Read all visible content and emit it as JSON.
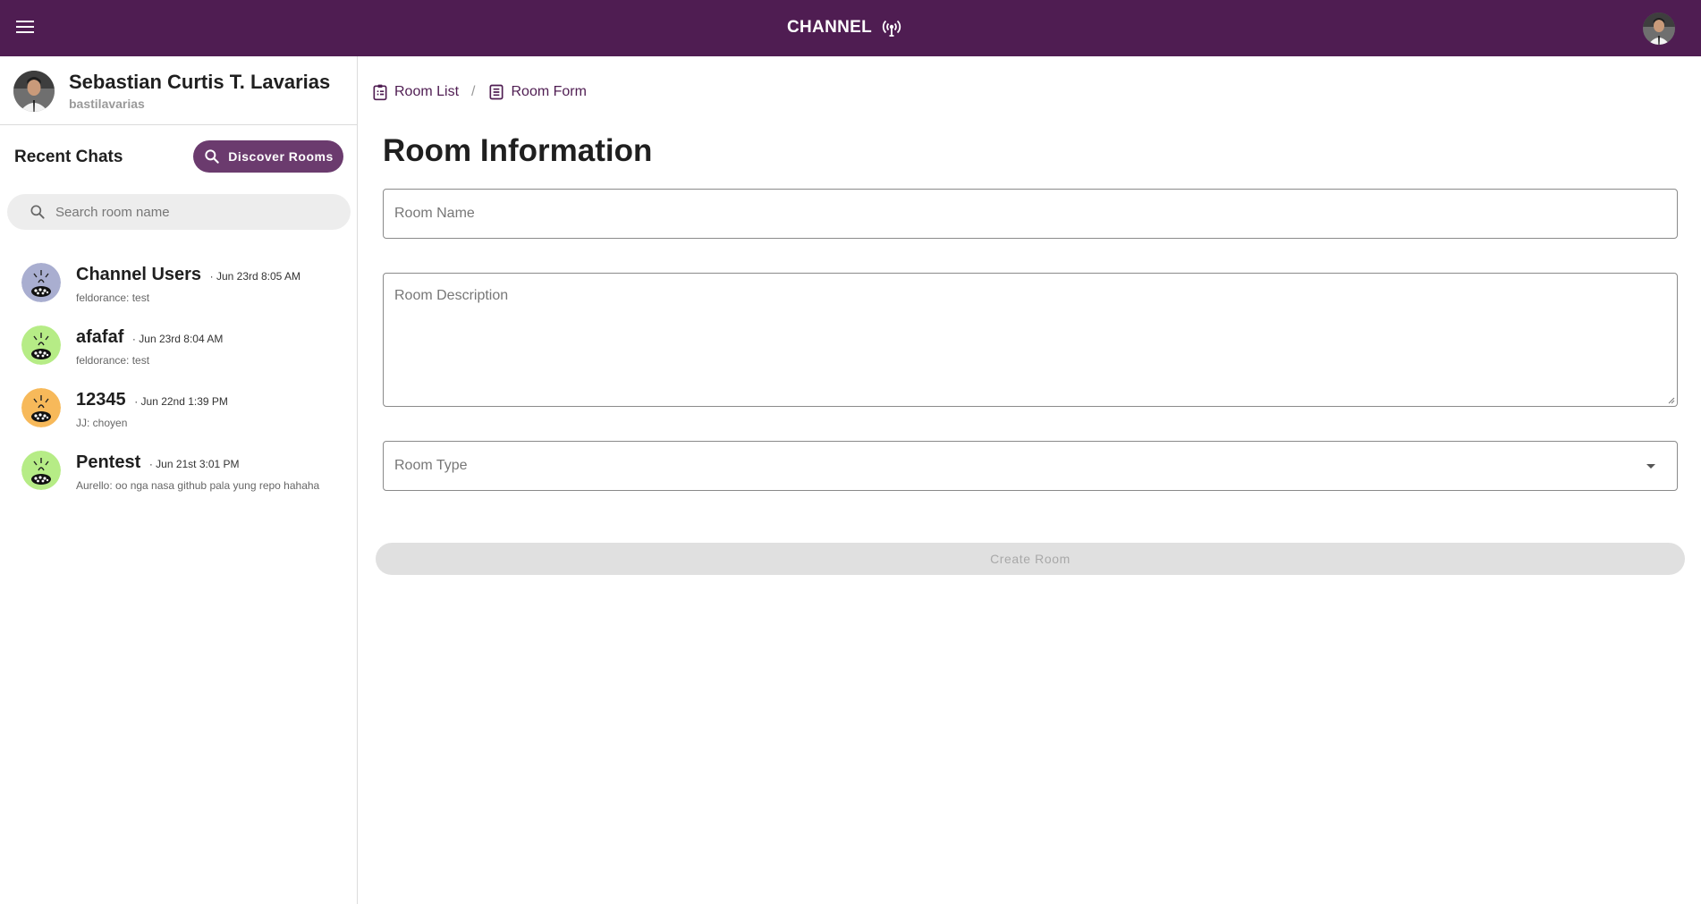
{
  "app": {
    "title": "CHANNEL",
    "brand_color": "#4f1d52",
    "brand_icon": "broadcast-icon"
  },
  "user": {
    "name": "Sebastian Curtis T. Lavarias",
    "handle": "bastilavarias"
  },
  "sidebar": {
    "recent_title": "Recent Chats",
    "discover_label": "Discover Rooms",
    "search_placeholder": "Search room name",
    "chats": [
      {
        "name": "Channel Users",
        "time": "Jun 23rd 8:05 AM",
        "preview": "feldorance: test",
        "avatar_color": "#a9aed0"
      },
      {
        "name": "afafaf",
        "time": "Jun 23rd 8:04 AM",
        "preview": "feldorance: test",
        "avatar_color": "#b6ec86"
      },
      {
        "name": "12345",
        "time": "Jun 22nd 1:39 PM",
        "preview": "JJ: choyen",
        "avatar_color": "#f7b95a"
      },
      {
        "name": "Pentest",
        "time": "Jun 21st 3:01 PM",
        "preview": "Aurello: oo nga nasa github pala yung repo hahaha",
        "avatar_color": "#b6ec86"
      }
    ]
  },
  "main": {
    "breadcrumb": {
      "list_label": "Room List",
      "separator": "/",
      "form_label": "Room Form"
    },
    "title": "Room Information",
    "form": {
      "name_placeholder": "Room Name",
      "name_value": "",
      "description_placeholder": "Room Description",
      "description_value": "",
      "type_label": "Room Type",
      "submit_label": "Create Room"
    }
  }
}
